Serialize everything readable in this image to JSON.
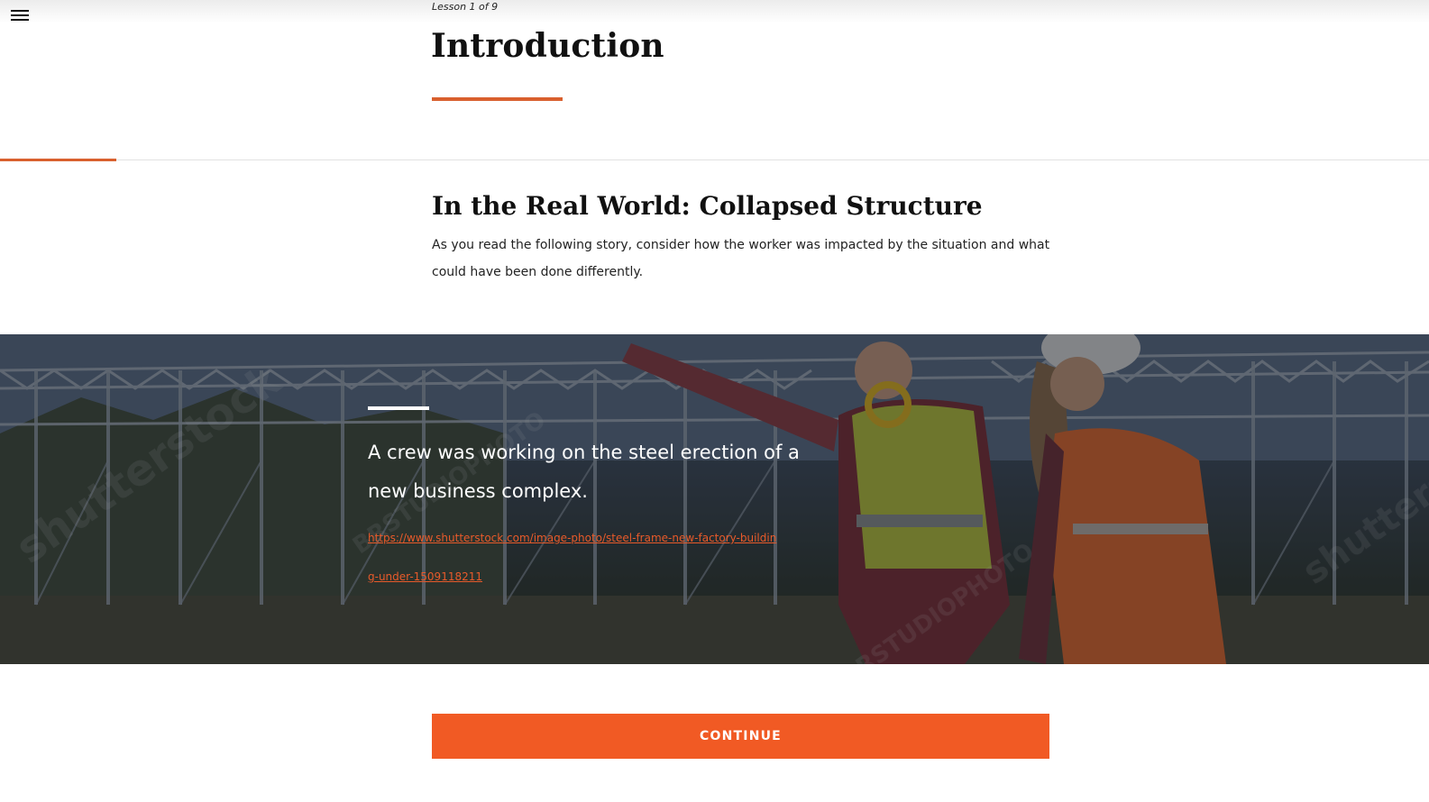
{
  "header": {
    "menu_icon": "hamburger-menu-icon",
    "lesson_label": "Lesson 1 of 9",
    "lesson_title": "Introduction"
  },
  "progress": {
    "fraction": 0.0815
  },
  "section": {
    "heading": "In the Real World: Collapsed Structure",
    "body": "As you read the following story, consider how the worker was impacted by the situation and what could have been done differently."
  },
  "banner": {
    "quote": "A crew was working on the steel erection of a new business complex.",
    "link_text": "https://www.shutterstock.com/image-photo/steel-frame-new-factory-building-under-1509118211",
    "image_watermark": "shutterstock"
  },
  "actions": {
    "continue_label": "CONTINUE"
  },
  "colors": {
    "accent": "#d9602e",
    "button": "#f15a24",
    "link": "#e85a2a"
  }
}
